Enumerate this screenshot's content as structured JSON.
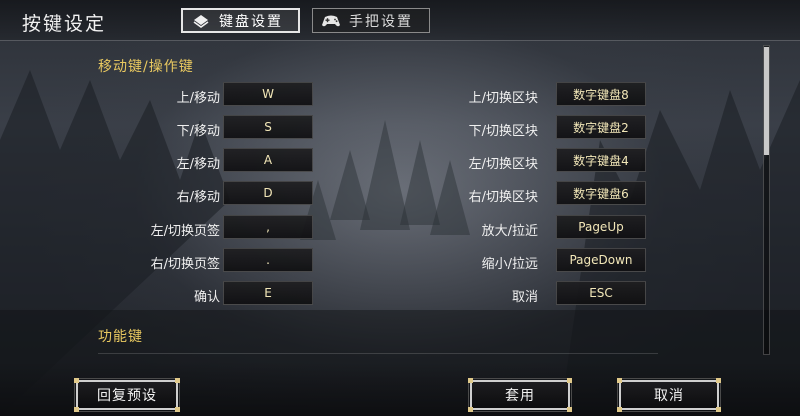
{
  "header": {
    "title": "按键设定",
    "tabs": [
      {
        "label": "键盘设置",
        "icon": "keyboard-icon",
        "active": true
      },
      {
        "label": "手把设置",
        "icon": "gamepad-icon",
        "active": false
      }
    ]
  },
  "sections": {
    "movement": {
      "title": "移动键/操作键",
      "left": [
        {
          "label": "上/移动",
          "key": "W"
        },
        {
          "label": "下/移动",
          "key": "S"
        },
        {
          "label": "左/移动",
          "key": "A"
        },
        {
          "label": "右/移动",
          "key": "D"
        },
        {
          "label": "左/切换页签",
          "key": ","
        },
        {
          "label": "右/切换页签",
          "key": "."
        },
        {
          "label": "确认",
          "key": "E"
        }
      ],
      "right": [
        {
          "label": "上/切换区块",
          "key": "数字键盘8"
        },
        {
          "label": "下/切换区块",
          "key": "数字键盘2"
        },
        {
          "label": "左/切换区块",
          "key": "数字键盘4"
        },
        {
          "label": "右/切换区块",
          "key": "数字键盘6"
        },
        {
          "label": "放大/拉近",
          "key": "PageUp"
        },
        {
          "label": "缩小/拉远",
          "key": "PageDown"
        },
        {
          "label": "取消",
          "key": "ESC"
        }
      ]
    },
    "function": {
      "title": "功能键"
    }
  },
  "footer": {
    "reset_label": "回复预设",
    "apply_label": "套用",
    "cancel_label": "取消"
  },
  "colors": {
    "accent": "#e8c860",
    "key_text": "#f2e7b8"
  }
}
